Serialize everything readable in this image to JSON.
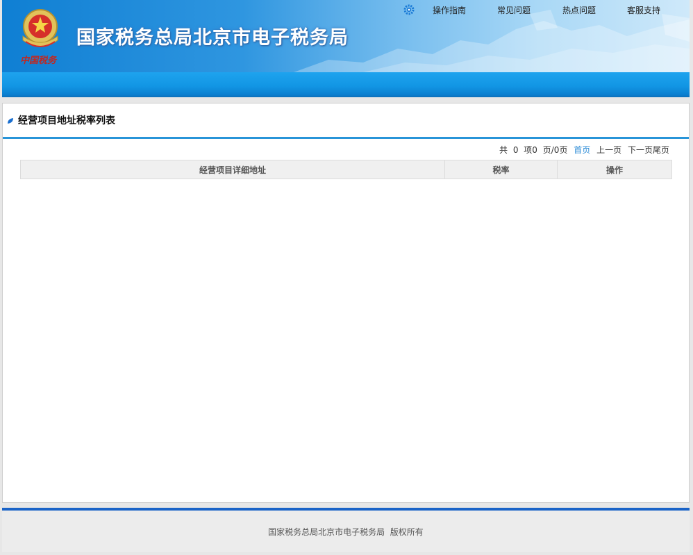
{
  "header": {
    "site_title": "国家税务总局北京市电子税务局",
    "logo_text": "中国税务",
    "nav": [
      {
        "label": "操作指南"
      },
      {
        "label": "常见问题"
      },
      {
        "label": "热点问题"
      },
      {
        "label": "客服支持"
      }
    ],
    "icons": {
      "nav": "gear-icon",
      "logo": "tax-emblem-icon"
    }
  },
  "panel": {
    "title": "经营项目地址税率列表",
    "icon": "leaf-icon",
    "pager": {
      "total_prefix": "共",
      "total_count": "0",
      "total_suffix": "项0",
      "page_info": "页/0页",
      "first": "首页",
      "prev": "上一页",
      "next": "下一页",
      "last": "尾页"
    },
    "table": {
      "columns": [
        "经营项目详细地址",
        "税率",
        "操作"
      ],
      "rows": []
    }
  },
  "footer": {
    "copyright": "国家税务总局北京市电子税务局  版权所有"
  },
  "colors": {
    "header_blue": "#1296e4",
    "accent_line": "#2894d8",
    "footer_line": "#1a63c7",
    "link_blue": "#2a8ad6"
  }
}
